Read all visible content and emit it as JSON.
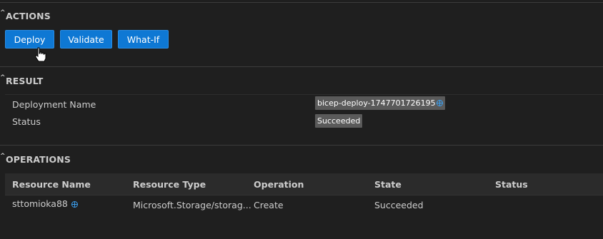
{
  "actions": {
    "title": "ACTIONS",
    "buttons": {
      "deploy": "Deploy",
      "validate": "Validate",
      "whatif": "What-If"
    }
  },
  "result": {
    "title": "RESULT",
    "deployment_name_label": "Deployment Name",
    "deployment_name_value": "bicep-deploy-1747701726195",
    "status_label": "Status",
    "status_value": "Succeeded"
  },
  "operations": {
    "title": "OPERATIONS",
    "columns": [
      "Resource Name",
      "Resource Type",
      "Operation",
      "State",
      "Status"
    ],
    "rows": [
      {
        "resource_name": "sttomioka88",
        "resource_type": "Microsoft.Storage/storag...",
        "operation": "Create",
        "state": "Succeeded",
        "status": ""
      }
    ]
  },
  "colors": {
    "background": "#1f1f1f",
    "button": "#0e78d4",
    "pill": "#5a5a5a",
    "link_icon": "#3a9ff0"
  }
}
